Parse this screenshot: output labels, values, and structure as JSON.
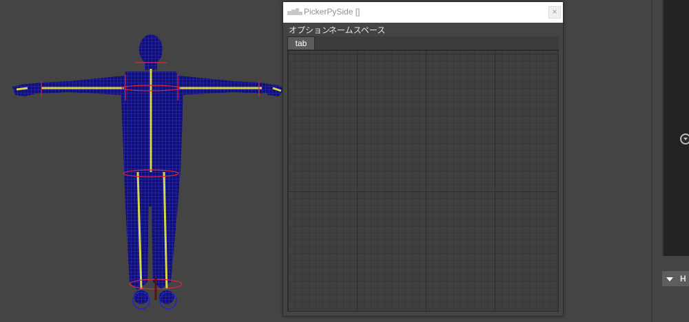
{
  "window": {
    "title": "PickerPySide []",
    "close_glyph": "×"
  },
  "menu": {
    "items": [
      {
        "label": "オプション"
      },
      {
        "label": "ネームスペース"
      }
    ]
  },
  "tabs": [
    {
      "label": "tab",
      "active": true
    }
  ],
  "right_panel": {
    "bottom_letter": "H"
  },
  "colors": {
    "viewport_bg": "#444444",
    "mesh_wire": "#1a1aa8",
    "joints": "#d6d64a",
    "controls": "#e0243a",
    "foot_controls": "#2222cc",
    "title_bg": "#ffffff",
    "tab_active_bg": "#5b5b5b"
  },
  "icons": {
    "window_icon": "app-icon",
    "close": "close-icon",
    "panel_toggle": "chevron-down-circle-icon",
    "section_toggle": "triangle-down-icon"
  }
}
